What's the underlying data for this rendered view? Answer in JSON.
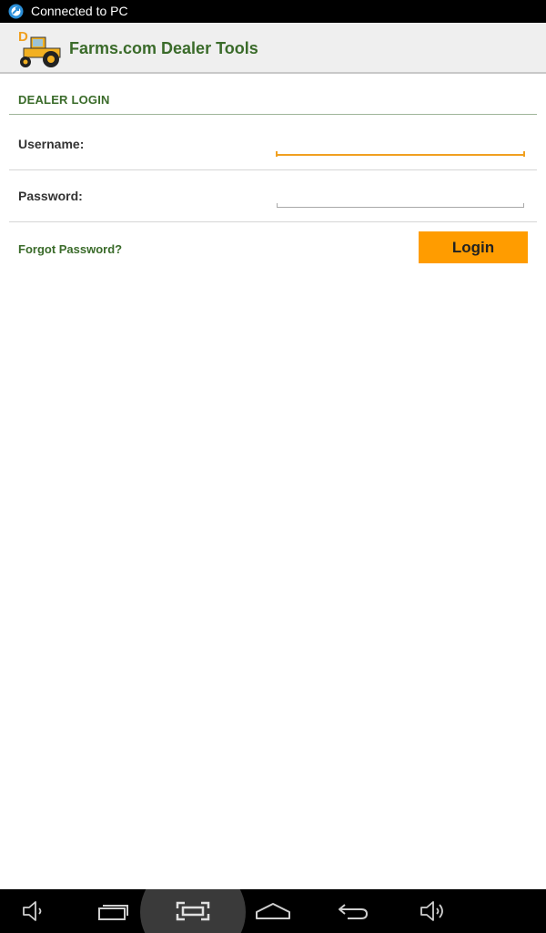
{
  "status_bar": {
    "notification_text": "Connected to PC",
    "icon": "usb-connected-icon"
  },
  "action_bar": {
    "app_icon": "tractor-logo-icon",
    "app_icon_letter": "D",
    "title": "Farms.com Dealer Tools"
  },
  "login_form": {
    "section_header": "DEALER LOGIN",
    "username_label": "Username:",
    "username_value": "",
    "password_label": "Password:",
    "password_value": "",
    "forgot_password": "Forgot Password?",
    "login_button": "Login"
  },
  "colors": {
    "accent_green": "#3a6b2a",
    "button_orange": "#ff9c00",
    "focus_underline": "#f0a020"
  },
  "nav_bar": {
    "buttons": [
      "volume-down-icon",
      "recent-apps-icon",
      "screenshot-icon",
      "home-icon",
      "back-icon",
      "volume-up-icon"
    ]
  }
}
